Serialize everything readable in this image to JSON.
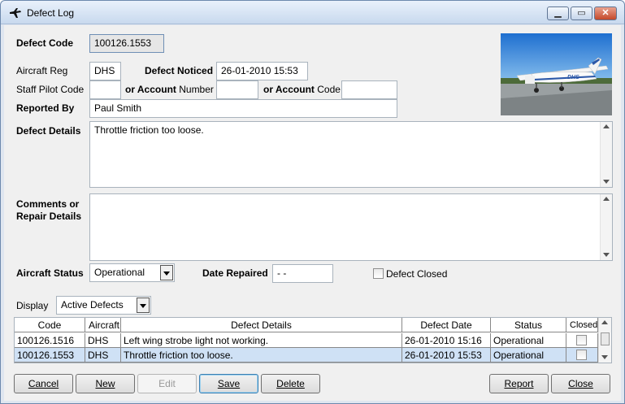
{
  "window": {
    "title": "Defect Log"
  },
  "form": {
    "defect_code_label": "Defect Code",
    "defect_code": "100126.1553",
    "aircraft_reg_label": "Aircraft Reg",
    "aircraft_reg": "DHS",
    "defect_noticed_label": "Defect Noticed",
    "defect_noticed": "26-01-2010 15:53",
    "staff_pilot_code_label": "Staff Pilot Code",
    "staff_pilot_code": "",
    "or_account_number_label_b": "or Account",
    "or_account_number_label_n": " Number",
    "account_number": "",
    "or_account_code_label_b": "or Account",
    "or_account_code_label_n": " Code",
    "account_code": "",
    "reported_by_label": "Reported By",
    "reported_by": "Paul Smith",
    "defect_details_label": "Defect Details",
    "defect_details": "Throttle friction too loose.",
    "comments_label_1": "Comments or",
    "comments_label_2": "Repair Details",
    "comments": "",
    "aircraft_status_label": "Aircraft Status",
    "aircraft_status": "Operational",
    "date_repaired_label": "Date Repaired",
    "date_repaired": "-  -",
    "defect_closed_label": "Defect Closed",
    "display_label": "Display",
    "display_value": "Active Defects"
  },
  "grid": {
    "headers": [
      "Code",
      "Aircraft",
      "Defect Details",
      "Defect Date",
      "Status",
      "Closed"
    ],
    "rows": [
      {
        "code": "100126.1516",
        "aircraft": "DHS",
        "details": "Left wing strobe light not working.",
        "date": "26-01-2010 15:16",
        "status": "Operational"
      },
      {
        "code": "100126.1553",
        "aircraft": "DHS",
        "details": "Throttle friction too loose.",
        "date": "26-01-2010 15:53",
        "status": "Operational"
      }
    ]
  },
  "buttons": {
    "cancel": "Cancel",
    "new": "New",
    "edit": "Edit",
    "save": "Save",
    "delete": "Delete",
    "report": "Report",
    "close": "Close"
  },
  "icons": {
    "app": "plane-icon",
    "minimize": "minimize-icon",
    "maximize": "maximize-icon",
    "close": "close-icon"
  },
  "photo_label": "DHS"
}
